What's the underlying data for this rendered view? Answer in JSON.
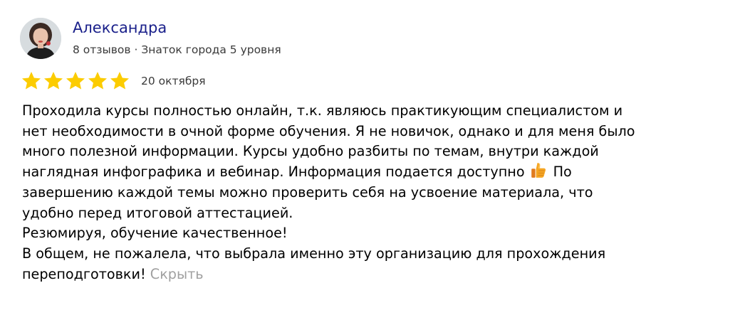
{
  "author": {
    "name": "Александра",
    "meta": "8 отзывов · Знаток города 5 уровня"
  },
  "rating": {
    "stars": 5,
    "max": 5,
    "star_color": "#fccc00"
  },
  "date": "20 октября",
  "review": {
    "lines": [
      "Проходила курсы полностью онлайн, т.к. являюсь практикующим специалистом и",
      "нет необходимости в очной форме обучения. Я не новичок, однако и для меня было",
      "много полезной информации. Курсы удобно разбиты по темам, внутри каждой",
      "наглядная инфографика и вебинар. Информация подается доступно",
      "По",
      "завершению каждой темы можно проверить себя на усвоение материала, что",
      "удобно перед итоговой аттестацией.",
      "Резюмируя, обучение качественное!",
      "В общем, не пожалела, что выбрала именно эту организацию для прохождения",
      "переподготовки!"
    ],
    "emoji_icon": "thumbs-up-icon",
    "collapse_label": "Скрыть"
  },
  "colors": {
    "author_name": "#191f8a",
    "meta_text": "#3a3a3a",
    "collapse_link": "#a0a0a0"
  }
}
